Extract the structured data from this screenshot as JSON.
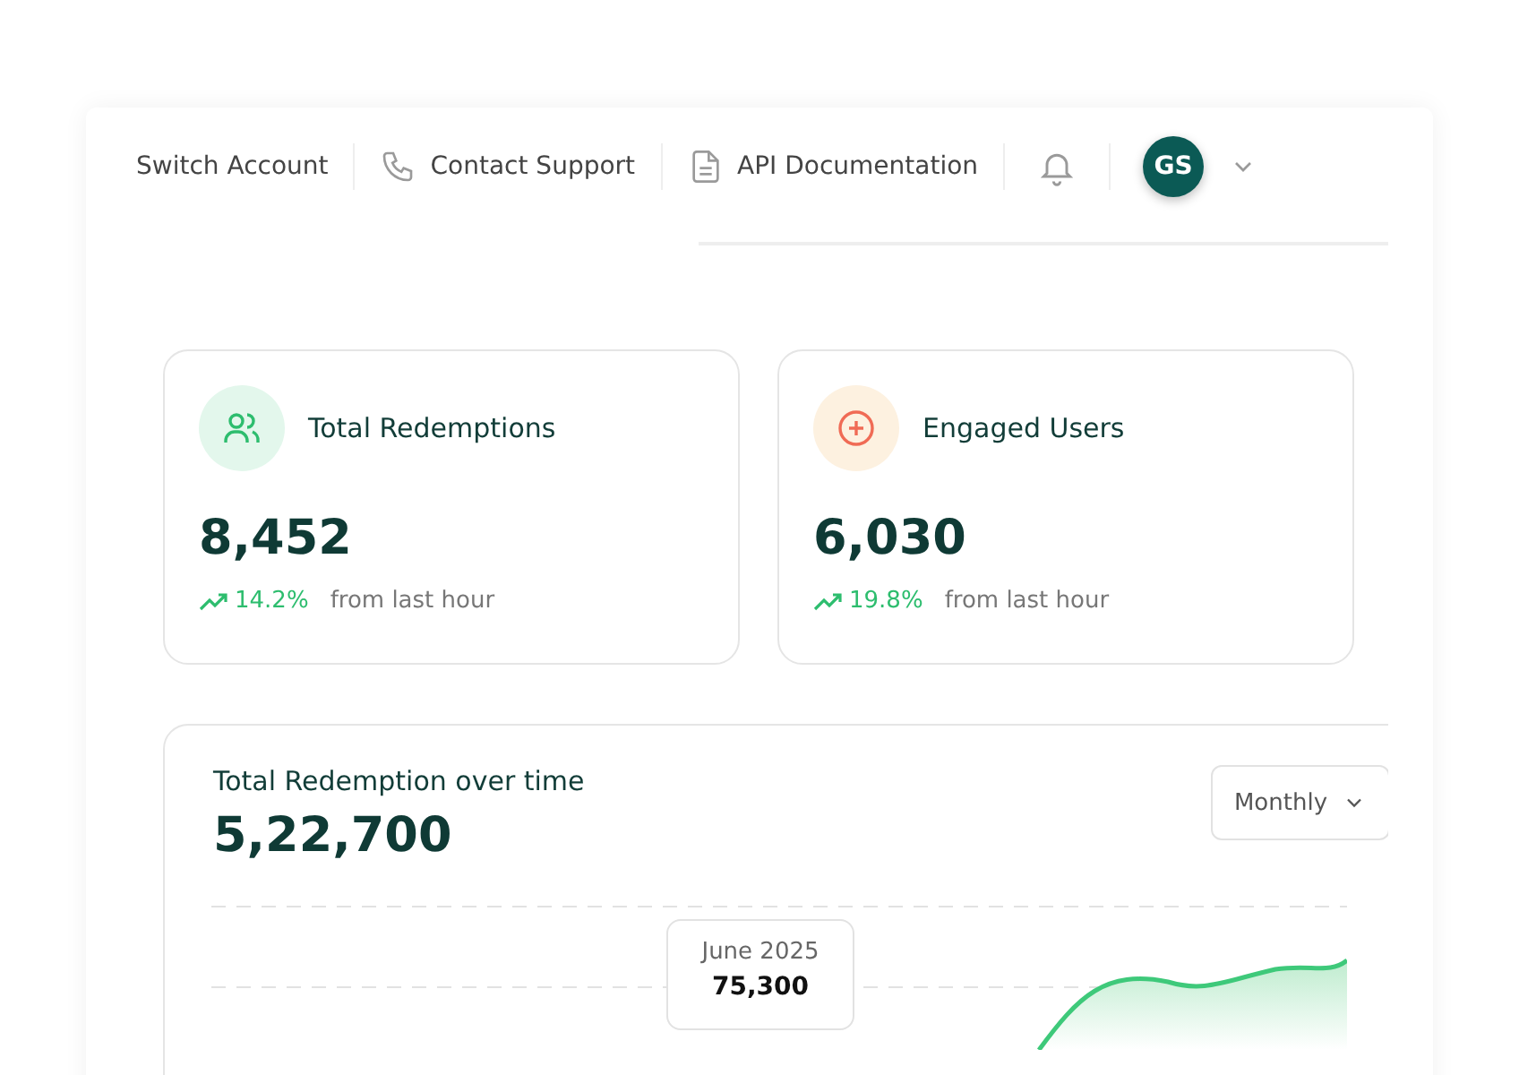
{
  "header": {
    "nav": [
      {
        "kind": "text",
        "label": "Switch Account"
      },
      {
        "kind": "phone",
        "label": "Contact Support"
      },
      {
        "kind": "document",
        "label": "API Documentation"
      }
    ],
    "avatar": {
      "initials": "GS"
    }
  },
  "stats": [
    {
      "kind": "users",
      "title": "Total Redemptions",
      "value": "8,452",
      "change": "14.2%",
      "note": "from last hour"
    },
    {
      "kind": "plus",
      "title": "Engaged Users",
      "value": "6,030",
      "change": "19.8%",
      "note": "from last hour"
    }
  ],
  "chart": {
    "title": "Total Redemption over time",
    "total": "5,22,700",
    "period": "Monthly",
    "tooltip": {
      "label": "June 2025",
      "value": "75,300"
    }
  }
}
